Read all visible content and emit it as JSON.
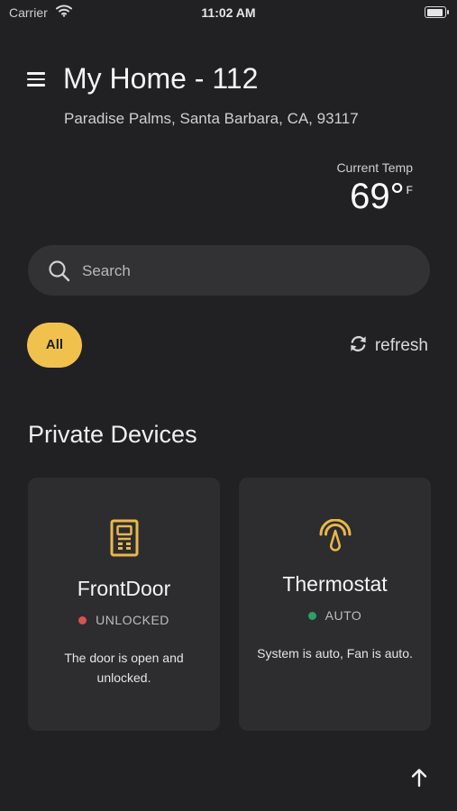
{
  "status_bar": {
    "carrier": "Carrier",
    "time": "11:02 AM"
  },
  "header": {
    "title": "My Home - 112",
    "address": "Paradise Palms, Santa Barbara, CA, 93117"
  },
  "temperature": {
    "label": "Current Temp",
    "value": "69°",
    "unit": "F"
  },
  "search": {
    "placeholder": "Search"
  },
  "filters": {
    "all_label": "All",
    "refresh_label": "refresh"
  },
  "section": {
    "title": "Private Devices"
  },
  "devices": [
    {
      "name": "FrontDoor",
      "status": "UNLOCKED",
      "status_color": "#d9534f",
      "description": "The door is open and unlocked.",
      "icon": "door-lock-icon"
    },
    {
      "name": "Thermostat",
      "status": "AUTO",
      "status_color": "#2e9e6a",
      "description": "System is auto, Fan is auto.",
      "icon": "thermostat-gauge-icon"
    }
  ],
  "colors": {
    "accent": "#f0c24d",
    "background": "#212123",
    "card": "#2d2d30"
  },
  "icons": [
    "menu-icon",
    "search-icon",
    "refresh-icon",
    "arrow-up-icon"
  ]
}
